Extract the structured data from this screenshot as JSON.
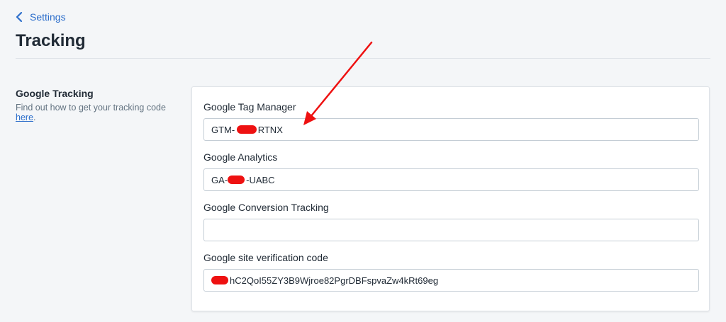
{
  "nav": {
    "back_label": "Settings"
  },
  "page": {
    "title": "Tracking"
  },
  "section": {
    "title": "Google Tracking",
    "description": "Find out how to get your tracking code ",
    "link_text": "here",
    "description_end": "."
  },
  "fields": {
    "gtm": {
      "label": "Google Tag Manager",
      "value": "GTM-   RTNX"
    },
    "ga": {
      "label": "Google Analytics",
      "value": "GA-  -UABC"
    },
    "conversion": {
      "label": "Google Conversion Tracking",
      "value": ""
    },
    "verification": {
      "label": "Google site verification code",
      "value": "  hC2QoI55ZY3B9Wjroe82PgrDBFspvaZw4kRt69eg"
    }
  },
  "colors": {
    "accent": "#2c6ecb",
    "annotation": "#ee1111"
  }
}
